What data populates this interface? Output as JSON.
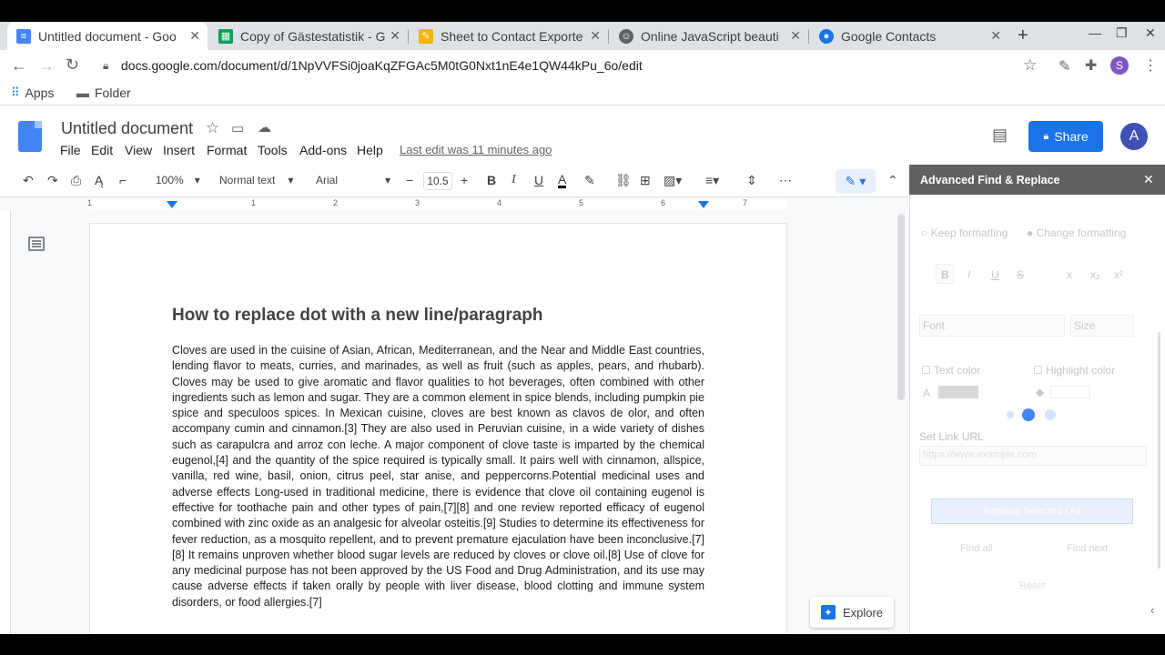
{
  "browser": {
    "tabs": [
      {
        "label": "Untitled document - Goo",
        "icon": "docs-icon",
        "active": true
      },
      {
        "label": "Copy of Gästestatistik - G",
        "icon": "sheets-icon",
        "active": false
      },
      {
        "label": "Sheet to Contact Exporte",
        "icon": "script-icon",
        "active": false
      },
      {
        "label": "Online JavaScript beauti",
        "icon": "beautifier-icon",
        "active": false
      },
      {
        "label": "Google Contacts",
        "icon": "contacts-icon",
        "active": false
      }
    ],
    "new_tab": "+",
    "url": "docs.google.com/document/d/1NpVVFSi0joaKqZFGAc5M0tG0Nxt1nE4e1QW44kPu_6o/edit",
    "profile_initial": "S",
    "bookmarks": [
      {
        "label": "Apps"
      },
      {
        "label": "Folder"
      }
    ]
  },
  "docs": {
    "title": "Untitled document",
    "menus": [
      "File",
      "Edit",
      "View",
      "Insert",
      "Format",
      "Tools",
      "Add-ons",
      "Help"
    ],
    "last_edit": "Last edit was 11 minutes ago",
    "share_label": "Share",
    "avatar_initial": "A",
    "toolbar": {
      "zoom": "100%",
      "style": "Normal text",
      "font": "Arial",
      "font_size": "10.5",
      "bold": "B",
      "italic": "I",
      "underline": "U",
      "text_color": "A"
    },
    "ruler_numbers": [
      "1",
      "1",
      "2",
      "3",
      "4",
      "5",
      "6",
      "7"
    ],
    "heading": "How to replace dot with a new line/paragraph",
    "body": "Cloves are used in the cuisine of Asian, African, Mediterranean, and the Near and Middle East countries, lending flavor to meats, curries, and marinades, as well as fruit (such as apples, pears, and rhubarb). Cloves may be used to give aromatic and flavor qualities to hot beverages, often combined with other ingredients such as lemon and sugar. They are a common element in spice blends, including pumpkin pie spice and speculoos spices. In Mexican cuisine, cloves are best known as clavos de olor, and often accompany cumin and cinnamon.[3] They are also used in Peruvian cuisine, in a wide variety of dishes such as carapulcra and arroz con leche. A major component of clove taste is imparted by the chemical eugenol,[4] and the quantity of the spice required is typically small. It pairs well with cinnamon, allspice, vanilla, red wine, basil, onion, citrus peel, star anise, and peppercorns.Potential medicinal uses and adverse effects Long-used in traditional medicine, there is evidence that clove oil containing eugenol is effective for toothache pain and other types of pain,[7][8] and one review reported efficacy of eugenol combined with zinc oxide as an analgesic for alveolar osteitis.[9] Studies to determine its effectiveness for fever reduction, as a mosquito repellent, and to prevent premature ejaculation have been inconclusive.[7][8] It remains unproven whether blood sugar levels are reduced by cloves or clove oil.[8] Use of clove for any medicinal purpose has not been approved by the US Food and Drug Administration, and its use may cause adverse effects if taken orally by people with liver disease, blood clotting and immune system disorders, or food allergies.[7]",
    "explore_label": "Explore"
  },
  "panel": {
    "title": "Advanced Find & Replace",
    "keep_formatting": "Keep formatting",
    "change_formatting": "Change formatting",
    "format_buttons": [
      "B",
      "I",
      "U",
      "S",
      "x",
      "x₂",
      "x²"
    ],
    "font_placeholder": "Font",
    "size_placeholder": "Size",
    "text_color": "Text color",
    "highlight_color": "Highlight color",
    "link_label": "Set Link URL",
    "link_placeholder": "https://www.example.com",
    "replace_button": "Replace Selected / All",
    "find_all": "Find all",
    "find_next": "Find next",
    "reset": "Reset"
  },
  "colors": {
    "docs_blue": "#4285f4",
    "share_blue": "#1a73e8",
    "panel_header": "#616161"
  }
}
